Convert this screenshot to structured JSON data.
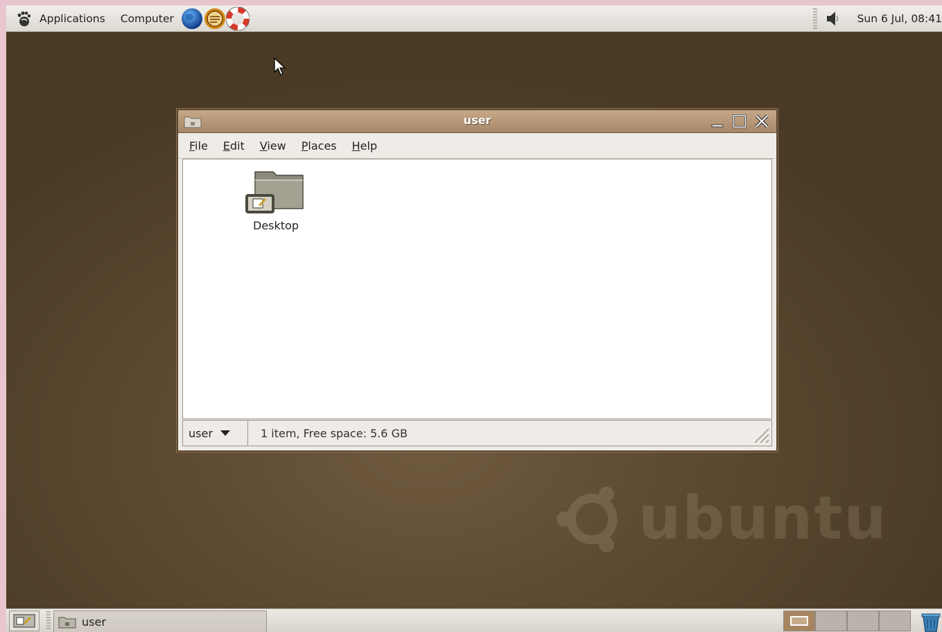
{
  "top_panel": {
    "applications_label": "Applications",
    "computer_label": "Computer",
    "clock": "Sun  6 Jul, 08:41"
  },
  "window": {
    "title": "user",
    "menu": {
      "file": {
        "mnemonic": "F",
        "rest": "ile"
      },
      "edit": {
        "mnemonic": "E",
        "rest": "dit"
      },
      "view": {
        "mnemonic": "V",
        "rest": "iew"
      },
      "places": {
        "mnemonic": "P",
        "rest": "laces"
      },
      "help": {
        "mnemonic": "H",
        "rest": "elp"
      }
    },
    "items": [
      {
        "label": "Desktop",
        "icon": "folder-desktop-icon"
      }
    ],
    "location_value": "user",
    "status_text": "1 item, Free space: 5.6 GB"
  },
  "taskbar": {
    "task_label": "user"
  },
  "watermark": {
    "text": "ubuntu"
  },
  "colors": {
    "desktop_bg": "#5d4a31",
    "titlebar": "#b8987a",
    "panel": "#e6e2dd"
  }
}
